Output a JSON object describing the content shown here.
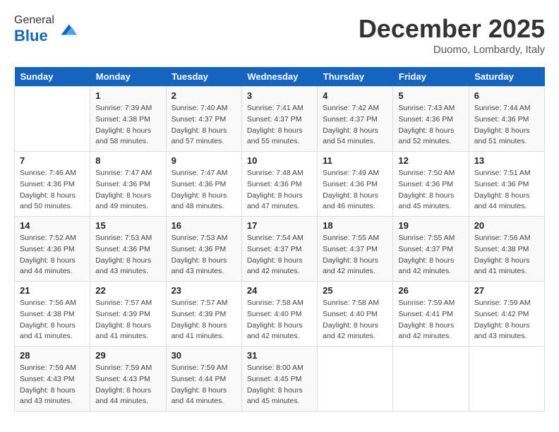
{
  "header": {
    "logo_line1": "General",
    "logo_line2": "Blue",
    "month": "December 2025",
    "location": "Duomo, Lombardy, Italy"
  },
  "weekdays": [
    "Sunday",
    "Monday",
    "Tuesday",
    "Wednesday",
    "Thursday",
    "Friday",
    "Saturday"
  ],
  "weeks": [
    [
      {
        "day": "",
        "info": ""
      },
      {
        "day": "1",
        "info": "Sunrise: 7:39 AM\nSunset: 4:38 PM\nDaylight: 8 hours\nand 58 minutes."
      },
      {
        "day": "2",
        "info": "Sunrise: 7:40 AM\nSunset: 4:37 PM\nDaylight: 8 hours\nand 57 minutes."
      },
      {
        "day": "3",
        "info": "Sunrise: 7:41 AM\nSunset: 4:37 PM\nDaylight: 8 hours\nand 55 minutes."
      },
      {
        "day": "4",
        "info": "Sunrise: 7:42 AM\nSunset: 4:37 PM\nDaylight: 8 hours\nand 54 minutes."
      },
      {
        "day": "5",
        "info": "Sunrise: 7:43 AM\nSunset: 4:36 PM\nDaylight: 8 hours\nand 52 minutes."
      },
      {
        "day": "6",
        "info": "Sunrise: 7:44 AM\nSunset: 4:36 PM\nDaylight: 8 hours\nand 51 minutes."
      }
    ],
    [
      {
        "day": "7",
        "info": "Sunrise: 7:46 AM\nSunset: 4:36 PM\nDaylight: 8 hours\nand 50 minutes."
      },
      {
        "day": "8",
        "info": "Sunrise: 7:47 AM\nSunset: 4:36 PM\nDaylight: 8 hours\nand 49 minutes."
      },
      {
        "day": "9",
        "info": "Sunrise: 7:47 AM\nSunset: 4:36 PM\nDaylight: 8 hours\nand 48 minutes."
      },
      {
        "day": "10",
        "info": "Sunrise: 7:48 AM\nSunset: 4:36 PM\nDaylight: 8 hours\nand 47 minutes."
      },
      {
        "day": "11",
        "info": "Sunrise: 7:49 AM\nSunset: 4:36 PM\nDaylight: 8 hours\nand 46 minutes."
      },
      {
        "day": "12",
        "info": "Sunrise: 7:50 AM\nSunset: 4:36 PM\nDaylight: 8 hours\nand 45 minutes."
      },
      {
        "day": "13",
        "info": "Sunrise: 7:51 AM\nSunset: 4:36 PM\nDaylight: 8 hours\nand 44 minutes."
      }
    ],
    [
      {
        "day": "14",
        "info": "Sunrise: 7:52 AM\nSunset: 4:36 PM\nDaylight: 8 hours\nand 44 minutes."
      },
      {
        "day": "15",
        "info": "Sunrise: 7:53 AM\nSunset: 4:36 PM\nDaylight: 8 hours\nand 43 minutes."
      },
      {
        "day": "16",
        "info": "Sunrise: 7:53 AM\nSunset: 4:36 PM\nDaylight: 8 hours\nand 43 minutes."
      },
      {
        "day": "17",
        "info": "Sunrise: 7:54 AM\nSunset: 4:37 PM\nDaylight: 8 hours\nand 42 minutes."
      },
      {
        "day": "18",
        "info": "Sunrise: 7:55 AM\nSunset: 4:37 PM\nDaylight: 8 hours\nand 42 minutes."
      },
      {
        "day": "19",
        "info": "Sunrise: 7:55 AM\nSunset: 4:37 PM\nDaylight: 8 hours\nand 42 minutes."
      },
      {
        "day": "20",
        "info": "Sunrise: 7:56 AM\nSunset: 4:38 PM\nDaylight: 8 hours\nand 41 minutes."
      }
    ],
    [
      {
        "day": "21",
        "info": "Sunrise: 7:56 AM\nSunset: 4:38 PM\nDaylight: 8 hours\nand 41 minutes."
      },
      {
        "day": "22",
        "info": "Sunrise: 7:57 AM\nSunset: 4:39 PM\nDaylight: 8 hours\nand 41 minutes."
      },
      {
        "day": "23",
        "info": "Sunrise: 7:57 AM\nSunset: 4:39 PM\nDaylight: 8 hours\nand 41 minutes."
      },
      {
        "day": "24",
        "info": "Sunrise: 7:58 AM\nSunset: 4:40 PM\nDaylight: 8 hours\nand 42 minutes."
      },
      {
        "day": "25",
        "info": "Sunrise: 7:58 AM\nSunset: 4:40 PM\nDaylight: 8 hours\nand 42 minutes."
      },
      {
        "day": "26",
        "info": "Sunrise: 7:59 AM\nSunset: 4:41 PM\nDaylight: 8 hours\nand 42 minutes."
      },
      {
        "day": "27",
        "info": "Sunrise: 7:59 AM\nSunset: 4:42 PM\nDaylight: 8 hours\nand 43 minutes."
      }
    ],
    [
      {
        "day": "28",
        "info": "Sunrise: 7:59 AM\nSunset: 4:43 PM\nDaylight: 8 hours\nand 43 minutes."
      },
      {
        "day": "29",
        "info": "Sunrise: 7:59 AM\nSunset: 4:43 PM\nDaylight: 8 hours\nand 44 minutes."
      },
      {
        "day": "30",
        "info": "Sunrise: 7:59 AM\nSunset: 4:44 PM\nDaylight: 8 hours\nand 44 minutes."
      },
      {
        "day": "31",
        "info": "Sunrise: 8:00 AM\nSunset: 4:45 PM\nDaylight: 8 hours\nand 45 minutes."
      },
      {
        "day": "",
        "info": ""
      },
      {
        "day": "",
        "info": ""
      },
      {
        "day": "",
        "info": ""
      }
    ]
  ]
}
